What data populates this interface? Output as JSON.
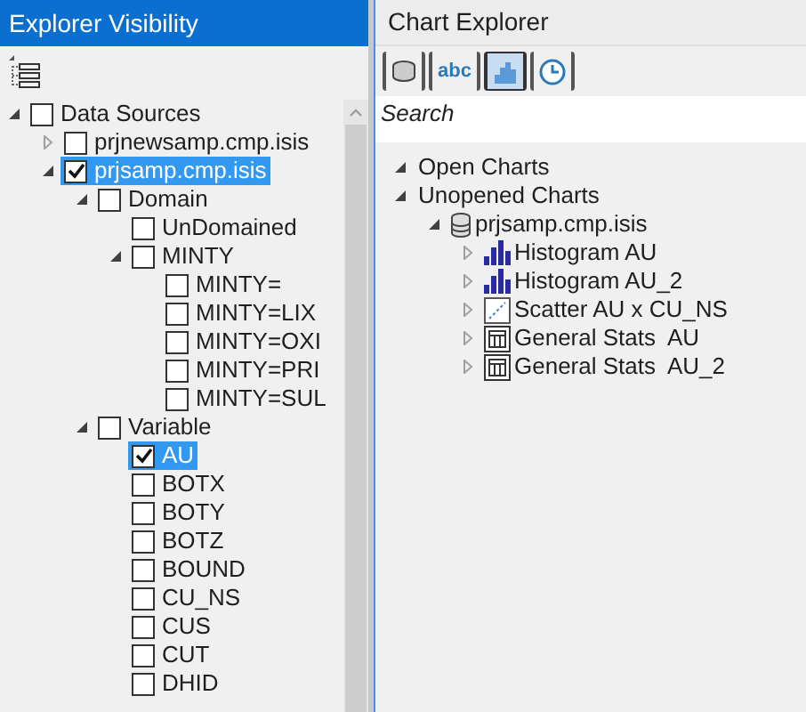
{
  "left_panel": {
    "title": "Explorer Visibility",
    "tree": [
      {
        "label": "Data Sources",
        "checked": false,
        "selected": false,
        "expanded": true,
        "children": [
          {
            "label": "prjnewsamp.cmp.isis",
            "checked": false,
            "selected": false,
            "expanded": false
          },
          {
            "label": "prjsamp.cmp.isis",
            "checked": true,
            "selected": true,
            "expanded": true,
            "children": [
              {
                "label": "Domain",
                "checked": false,
                "selected": false,
                "expanded": true,
                "children": [
                  {
                    "label": "UnDomained",
                    "checked": false,
                    "selected": false
                  },
                  {
                    "label": "MINTY",
                    "checked": false,
                    "selected": false,
                    "expanded": true,
                    "children": [
                      {
                        "label": "MINTY=",
                        "checked": false,
                        "selected": false
                      },
                      {
                        "label": "MINTY=LIX",
                        "checked": false,
                        "selected": false
                      },
                      {
                        "label": "MINTY=OXI",
                        "checked": false,
                        "selected": false
                      },
                      {
                        "label": "MINTY=PRI",
                        "checked": false,
                        "selected": false
                      },
                      {
                        "label": "MINTY=SUL",
                        "checked": false,
                        "selected": false
                      }
                    ]
                  }
                ]
              },
              {
                "label": "Variable",
                "checked": false,
                "selected": false,
                "expanded": true,
                "children": [
                  {
                    "label": "AU",
                    "checked": true,
                    "selected": true
                  },
                  {
                    "label": "BOTX",
                    "checked": false,
                    "selected": false
                  },
                  {
                    "label": "BOTY",
                    "checked": false,
                    "selected": false
                  },
                  {
                    "label": "BOTZ",
                    "checked": false,
                    "selected": false
                  },
                  {
                    "label": "BOUND",
                    "checked": false,
                    "selected": false
                  },
                  {
                    "label": "CU_NS",
                    "checked": false,
                    "selected": false
                  },
                  {
                    "label": "CUS",
                    "checked": false,
                    "selected": false
                  },
                  {
                    "label": "CUT",
                    "checked": false,
                    "selected": false
                  },
                  {
                    "label": "DHID",
                    "checked": false,
                    "selected": false
                  }
                ]
              }
            ]
          }
        ]
      }
    ]
  },
  "right_panel": {
    "title": "Chart Explorer",
    "toolbar": [
      {
        "kind": "database",
        "selected": false
      },
      {
        "kind": "text",
        "glyph": "abc",
        "selected": false
      },
      {
        "kind": "chart",
        "selected": true
      },
      {
        "kind": "clock",
        "selected": false
      }
    ],
    "search": {
      "placeholder": "Search"
    },
    "tree": [
      {
        "label": "Open Charts",
        "expanded": true
      },
      {
        "label": "Unopened Charts",
        "expanded": true,
        "children": [
          {
            "label": "prjsamp.cmp.isis",
            "kind": "database",
            "expanded": true,
            "children": [
              {
                "label": "Histogram AU",
                "kind": "histogram",
                "expanded": false
              },
              {
                "label": "Histogram AU_2",
                "kind": "histogram",
                "expanded": false
              },
              {
                "label": "Scatter AU x CU_NS",
                "kind": "scatter",
                "expanded": false
              },
              {
                "label": "General Stats  AU",
                "kind": "table",
                "expanded": false
              },
              {
                "label": "General Stats  AU_2",
                "kind": "table",
                "expanded": false
              }
            ]
          }
        ]
      }
    ]
  }
}
